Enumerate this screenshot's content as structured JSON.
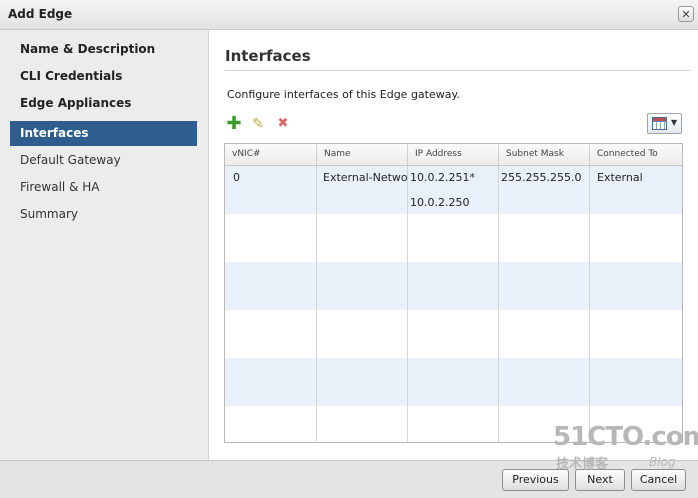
{
  "dialog": {
    "title": "Add Edge",
    "close_glyph": "✕"
  },
  "nav": {
    "items": [
      {
        "label": "Name & Description"
      },
      {
        "label": "CLI Credentials"
      },
      {
        "label": "Edge Appliances"
      },
      {
        "label": "Interfaces"
      },
      {
        "label": "Default Gateway"
      },
      {
        "label": "Firewall & HA"
      },
      {
        "label": "Summary"
      }
    ],
    "active_index": 3
  },
  "main": {
    "title": "Interfaces",
    "description": "Configure interfaces of this Edge gateway."
  },
  "toolbar": {
    "add_icon": "plus-icon",
    "edit_icon": "pencil-icon",
    "delete_icon": "x-icon",
    "column_chooser_icon": "columns-grid-icon"
  },
  "table": {
    "columns": [
      "vNIC#",
      "Name",
      "IP Address",
      "Subnet Mask",
      "Connected To"
    ],
    "rows": [
      {
        "vnic": "0",
        "name": "External-Netwo",
        "ip_primary": "10.0.2.251*",
        "ip_secondary": "10.0.2.250",
        "subnet": "255.255.255.0",
        "connected_to": "External"
      }
    ]
  },
  "footer": {
    "previous": "Previous",
    "next": "Next",
    "cancel": "Cancel"
  },
  "watermark": {
    "main": "51CTO.com",
    "sub": "技术博客",
    "blog": "Blog"
  },
  "colors": {
    "nav_active_bg": "#2e5d8e",
    "row_alt_bg": "#eaf0fa",
    "add_green": "#3a9a2c",
    "delete_red": "#d76b6b"
  }
}
